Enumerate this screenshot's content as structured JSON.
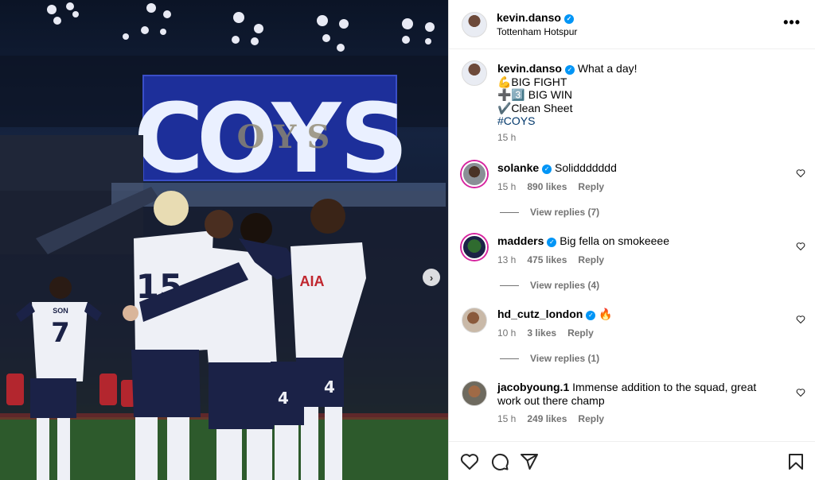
{
  "photo": {
    "scoreboard_letters": [
      "C",
      "O",
      "Y",
      "S"
    ],
    "scoreboard_shadow_letters": [
      "O",
      "Y",
      "S"
    ],
    "shirt_brand": "AIA",
    "jersey_numbers": [
      "15",
      "7",
      "4",
      "4"
    ],
    "jersey_name": "SON",
    "next_label": "›",
    "colors": {
      "scoreboard": "#1d2f9a",
      "shirt": "#eef0f6",
      "shorts": "#1b2247",
      "pitch": "#2d5a2c"
    }
  },
  "header": {
    "username": "kevin.danso",
    "subtitle": "Tottenham Hotspur",
    "more_label": "•••",
    "verified_mark": "✓"
  },
  "caption": {
    "username": "kevin.danso",
    "lines": [
      "What a day!",
      "💪BIG FIGHT",
      "➕3️⃣ BIG WIN",
      "✔️Clean Sheet"
    ],
    "hashtag": "#COYS",
    "time": "15 h"
  },
  "comments": [
    {
      "username": "solanke",
      "verified": true,
      "text": "Soliddddddd",
      "time": "15 h",
      "likes": "890 likes",
      "reply": "Reply",
      "view_replies": "View replies (7)"
    },
    {
      "username": "madders",
      "verified": true,
      "text": "Big fella on smokeeee",
      "time": "13 h",
      "likes": "475 likes",
      "reply": "Reply",
      "view_replies": "View replies (4)"
    },
    {
      "username": "hd_cutz_london",
      "verified": true,
      "text": "🔥",
      "time": "10 h",
      "likes": "3 likes",
      "reply": "Reply",
      "view_replies": "View replies (1)"
    },
    {
      "username": "jacobyoung.1",
      "verified": false,
      "text": "Immense addition to the squad, great work out there champ",
      "time": "15 h",
      "likes": "249 likes",
      "reply": "Reply"
    }
  ],
  "actions": {
    "icons": [
      "heart-icon",
      "comment-icon",
      "share-icon",
      "bookmark-icon"
    ]
  }
}
